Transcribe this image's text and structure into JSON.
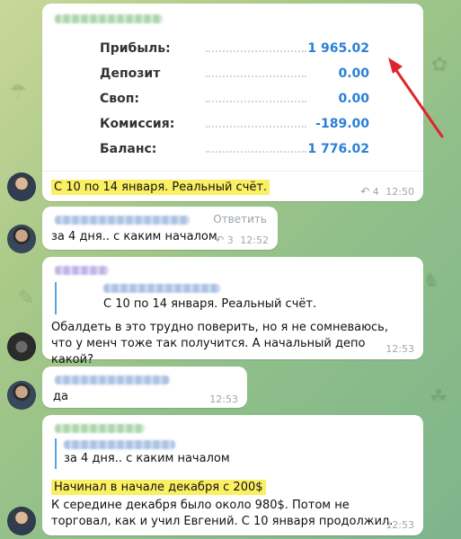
{
  "stats": {
    "rows": [
      {
        "label": "Прибыль:",
        "value": "1 965.02"
      },
      {
        "label": "Депозит",
        "value": "0.00"
      },
      {
        "label": "Своп:",
        "value": "0.00"
      },
      {
        "label": "Комиссия:",
        "value": "-189.00"
      },
      {
        "label": "Баланс:",
        "value": "1 776.02"
      }
    ]
  },
  "messages": {
    "m1": {
      "text": "С 10 по 14 января. Реальный счёт.",
      "replies": "4",
      "time": "12:50"
    },
    "m2": {
      "text": "за 4 дня.. с каким началом",
      "action": "Ответить",
      "replies": "3",
      "time": "12:52"
    },
    "m3": {
      "quote_text": "С 10 по 14 января. Реальный счёт.",
      "text": "Обалдеть в это трудно поверить, но я не сомневаюсь, что у менч тоже так получится. А начальный депо какой?",
      "time": "12:53"
    },
    "m4": {
      "text": "да",
      "time": "12:53"
    },
    "m5": {
      "quote_text": "за 4 дня.. с каким началом",
      "highlight": "Начинал в начале декабря с 200$",
      "text": "К середине декабря было около 980$. Потом не торговал, как и учил Евгений. С 10 января продолжил.",
      "time": "12:53"
    }
  },
  "icons": {
    "reply": "reply-arrow-icon",
    "annotation": "red-arrow-annotation"
  },
  "colors": {
    "value_blue": "#2a7fd6",
    "highlight": "#fbef63",
    "quote_bar": "#5aa0e6",
    "annotation": "#e0242c"
  }
}
